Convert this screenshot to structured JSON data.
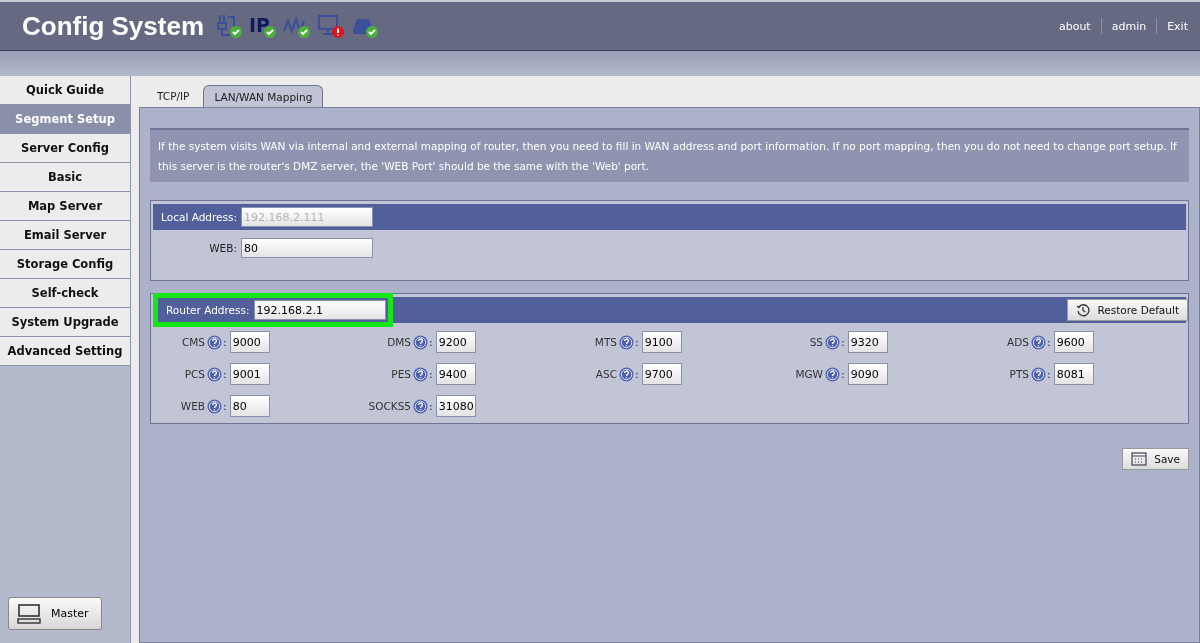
{
  "header": {
    "title": "Config System",
    "status_icons": [
      {
        "kind": "plug",
        "ok": true
      },
      {
        "kind": "ip",
        "glyph": "IP",
        "ok": true
      },
      {
        "kind": "wave",
        "ok": true
      },
      {
        "kind": "monitor",
        "ok": false
      },
      {
        "kind": "disk",
        "ok": true
      }
    ],
    "links": [
      "about",
      "admin",
      "Exit"
    ]
  },
  "sidebar": {
    "items": [
      {
        "label": "Quick Guide",
        "selected": false
      },
      {
        "label": "Segment Setup",
        "selected": true
      },
      {
        "label": "Server Config",
        "selected": false
      },
      {
        "label": "Basic",
        "selected": false
      },
      {
        "label": "Map Server",
        "selected": false
      },
      {
        "label": "Email Server",
        "selected": false
      },
      {
        "label": "Storage Config",
        "selected": false
      },
      {
        "label": "Self-check",
        "selected": false
      },
      {
        "label": "System Upgrade",
        "selected": false
      },
      {
        "label": "Advanced Setting",
        "selected": false
      }
    ],
    "master_button": "Master"
  },
  "tabs": [
    {
      "label": "TCP/IP",
      "selected": false
    },
    {
      "label": "LAN/WAN Mapping",
      "selected": true
    }
  ],
  "info": "If the system visits WAN via internal and external mapping of router, then you need to fill in WAN address and port information. If no port mapping, then you do not need to change port setup. If this server is the router's DMZ server, the 'WEB Port' should be the same with the 'Web' port.",
  "local": {
    "address_label": "Local Address:",
    "address": "192.168.2.111",
    "address_disabled": true,
    "web_label": "WEB:",
    "web": "80"
  },
  "router": {
    "address_label": "Router Address:",
    "address": "192.168.2.1",
    "highlighted": true,
    "restore_button": "Restore Default",
    "ports": [
      {
        "label": "CMS",
        "colon": ":",
        "value": "9000"
      },
      {
        "label": "DMS",
        "colon": ":",
        "value": "9200"
      },
      {
        "label": "MTS",
        "colon": ":",
        "value": "9100"
      },
      {
        "label": "SS",
        "colon": ":",
        "value": "9320"
      },
      {
        "label": "ADS",
        "colon": ":",
        "value": "9600"
      },
      {
        "label": "PCS",
        "colon": ":",
        "value": "9001"
      },
      {
        "label": "PES",
        "colon": ":",
        "value": "9400"
      },
      {
        "label": "ASC",
        "colon": ":",
        "value": "9700"
      },
      {
        "label": "MGW",
        "colon": ":",
        "value": "9090"
      },
      {
        "label": "PTS",
        "colon": ":",
        "value": "8081"
      },
      {
        "label": "WEB",
        "colon": ":",
        "value": "80"
      },
      {
        "label": "SOCKS5",
        "colon": ":",
        "value": "31080"
      }
    ]
  },
  "save_button": "Save"
}
